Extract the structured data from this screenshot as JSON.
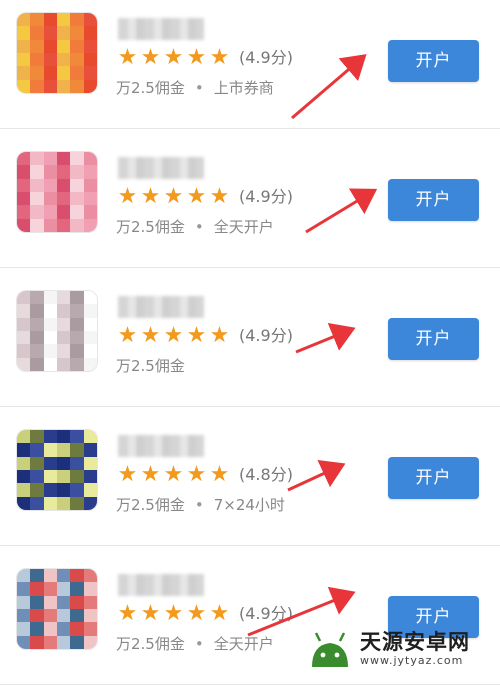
{
  "colors": {
    "accent": "#3d87db",
    "star": "#f29a1d",
    "arrow": "#e8353a"
  },
  "items": [
    {
      "score": "(4.9分)",
      "meta": [
        "万2.5佣金",
        "上市券商"
      ],
      "button": "开户",
      "logo": [
        "#f0b24a",
        "#e8503a",
        "#f07b3a",
        "#f5c842",
        "#e84a2e",
        "#f08a3a"
      ]
    },
    {
      "score": "(4.9分)",
      "meta": [
        "万2.5佣金",
        "全天开户"
      ],
      "button": "开户",
      "logo": [
        "#f2b8c4",
        "#e3667f",
        "#ec8ea1",
        "#f7d3db",
        "#d84e6c",
        "#f0a0b2"
      ]
    },
    {
      "score": "(4.9分)",
      "meta": [
        "万2.5佣金"
      ],
      "button": "开户",
      "logo": [
        "#f5f5f5",
        "#b8a9ae",
        "#d7c6cb",
        "#ffffff",
        "#a99ba0",
        "#e6dadd"
      ]
    },
    {
      "score": "(4.8分)",
      "meta": [
        "万2.5佣金",
        "7×24小时"
      ],
      "button": "开户",
      "logo": [
        "#1c2f7a",
        "#2a3d8c",
        "#6f7a3e",
        "#c9cf7a",
        "#e8ea9c",
        "#3a4fa0"
      ]
    },
    {
      "score": "(4.9分)",
      "meta": [
        "万2.5佣金",
        "全天开户"
      ],
      "button": "开户",
      "logo": [
        "#d94a4a",
        "#6f8fb8",
        "#eec4c4",
        "#3e6a90",
        "#b9c9dc",
        "#e57a7a"
      ]
    }
  ],
  "watermark": {
    "title": "天源安卓网",
    "url": "www.jytyaz.com"
  }
}
